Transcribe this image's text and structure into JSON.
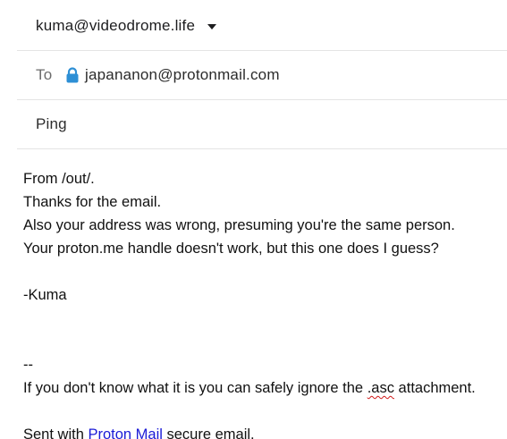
{
  "composer": {
    "from_address": "kuma@videodrome.life",
    "to_label": "To",
    "to_address": "japananon@protonmail.com",
    "subject": "Ping"
  },
  "body": {
    "line1": "From /out/.",
    "line2": "Thanks for the email.",
    "line3": "Also your address was wrong, presuming you're the same person.",
    "line4": "Your proton.me handle doesn't work, but this one does I guess?",
    "signoff": "-Kuma",
    "sig_separator": "--",
    "sig_text_before": "If you don't know what it is you can safely ignore the ",
    "sig_text_misspelled": ".asc",
    "sig_text_after": " attachment.",
    "sent_with_prefix": "Sent with ",
    "sent_with_link": "Proton Mail",
    "sent_with_suffix": " secure email."
  },
  "colors": {
    "lock_icon": "#2d8fd5",
    "link": "#1a1ad6",
    "spellcheck_underline": "#d11a1a"
  }
}
